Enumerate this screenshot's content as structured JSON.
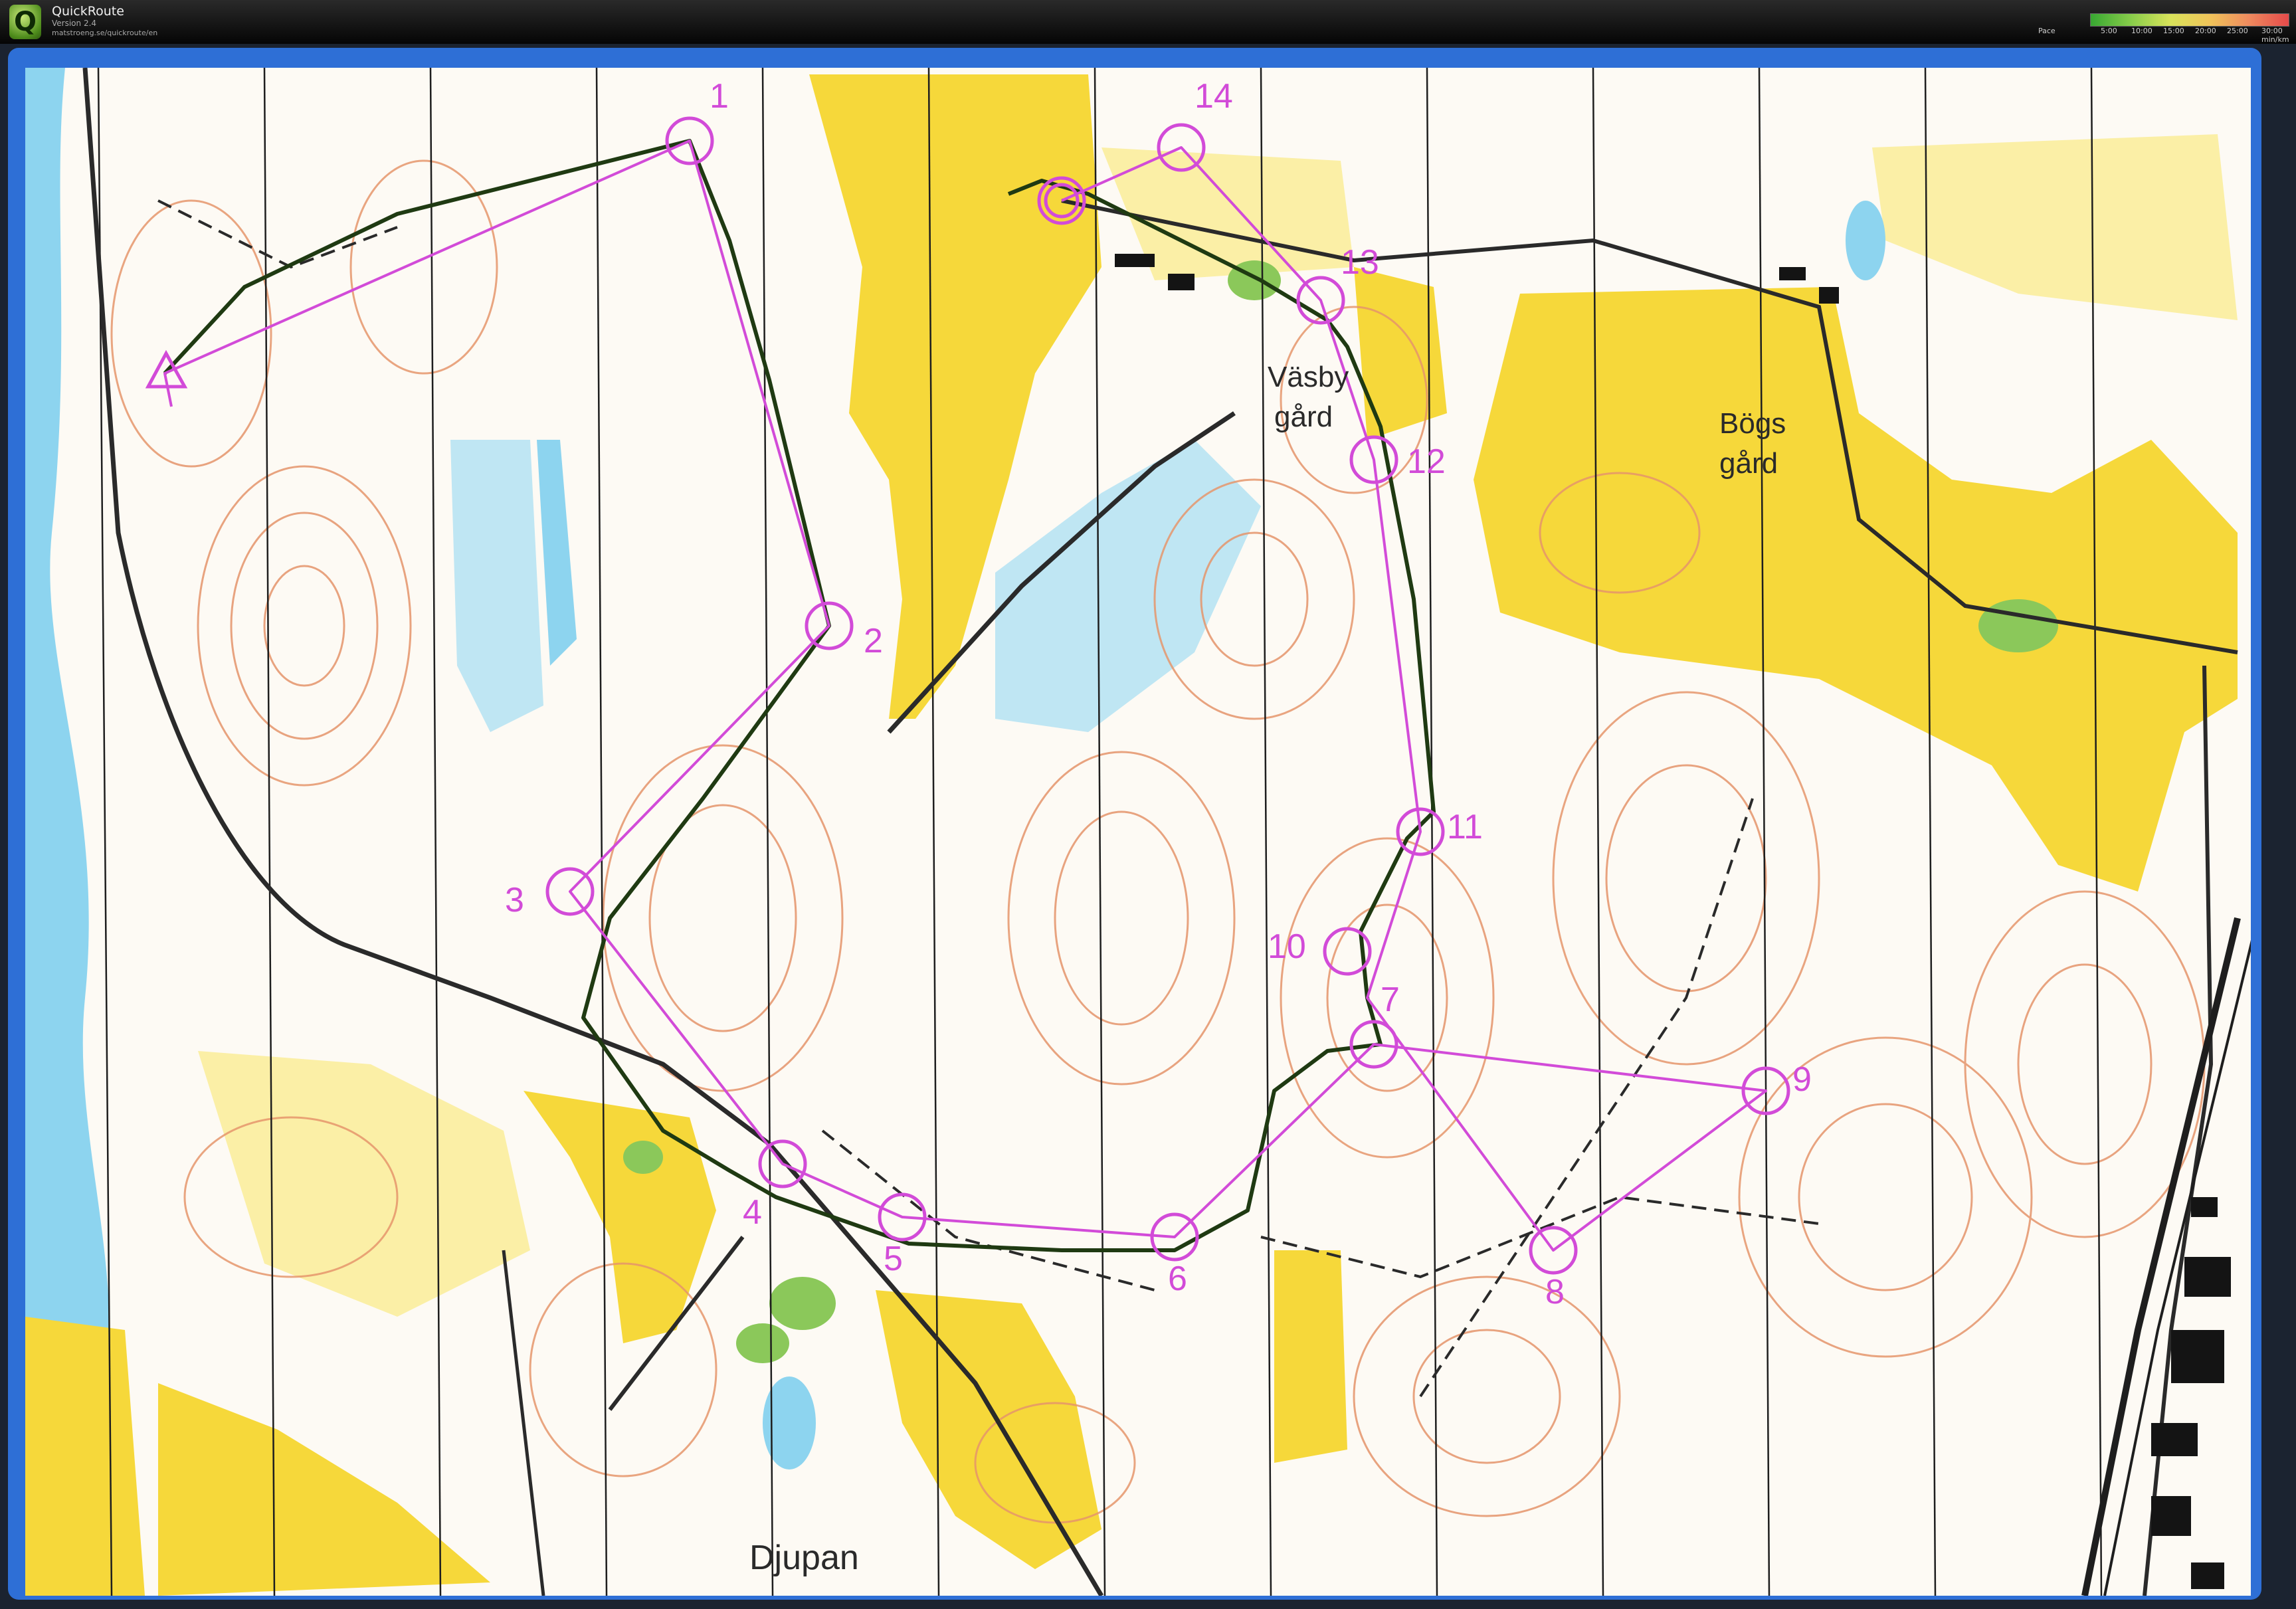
{
  "app": {
    "title": "QuickRoute",
    "version": "Version 2.4",
    "url": "matstroeng.se/quickroute/en",
    "logo_letter": "Q"
  },
  "pace_legend": {
    "label": "Pace",
    "ticks": [
      "5:00",
      "10:00",
      "15:00",
      "20:00",
      "25:00",
      "30:00"
    ],
    "unit": "min/km",
    "colors": [
      "#38a832",
      "#86cc4a",
      "#d8e35a",
      "#efc45a",
      "#ee8a5e",
      "#e54a4a"
    ]
  },
  "map": {
    "place_names": [
      "Väsby",
      "gård",
      "Bögs",
      "gård",
      "Djupan"
    ],
    "course_color": "#d24bd8",
    "route_color": "#1f3a12",
    "colors": {
      "open_land": "#f6d83a",
      "water": "#8dd4ef",
      "green": "#8bc85a",
      "contours": "#e5956b",
      "paper_white": "#fdfaf4",
      "frame_blue": "#2e6fd6"
    },
    "controls": [
      {
        "number": "1"
      },
      {
        "number": "2"
      },
      {
        "number": "3"
      },
      {
        "number": "4"
      },
      {
        "number": "5"
      },
      {
        "number": "6"
      },
      {
        "number": "7"
      },
      {
        "number": "8"
      },
      {
        "number": "9"
      },
      {
        "number": "10"
      },
      {
        "number": "11"
      },
      {
        "number": "12"
      },
      {
        "number": "13"
      },
      {
        "number": "14"
      }
    ]
  }
}
